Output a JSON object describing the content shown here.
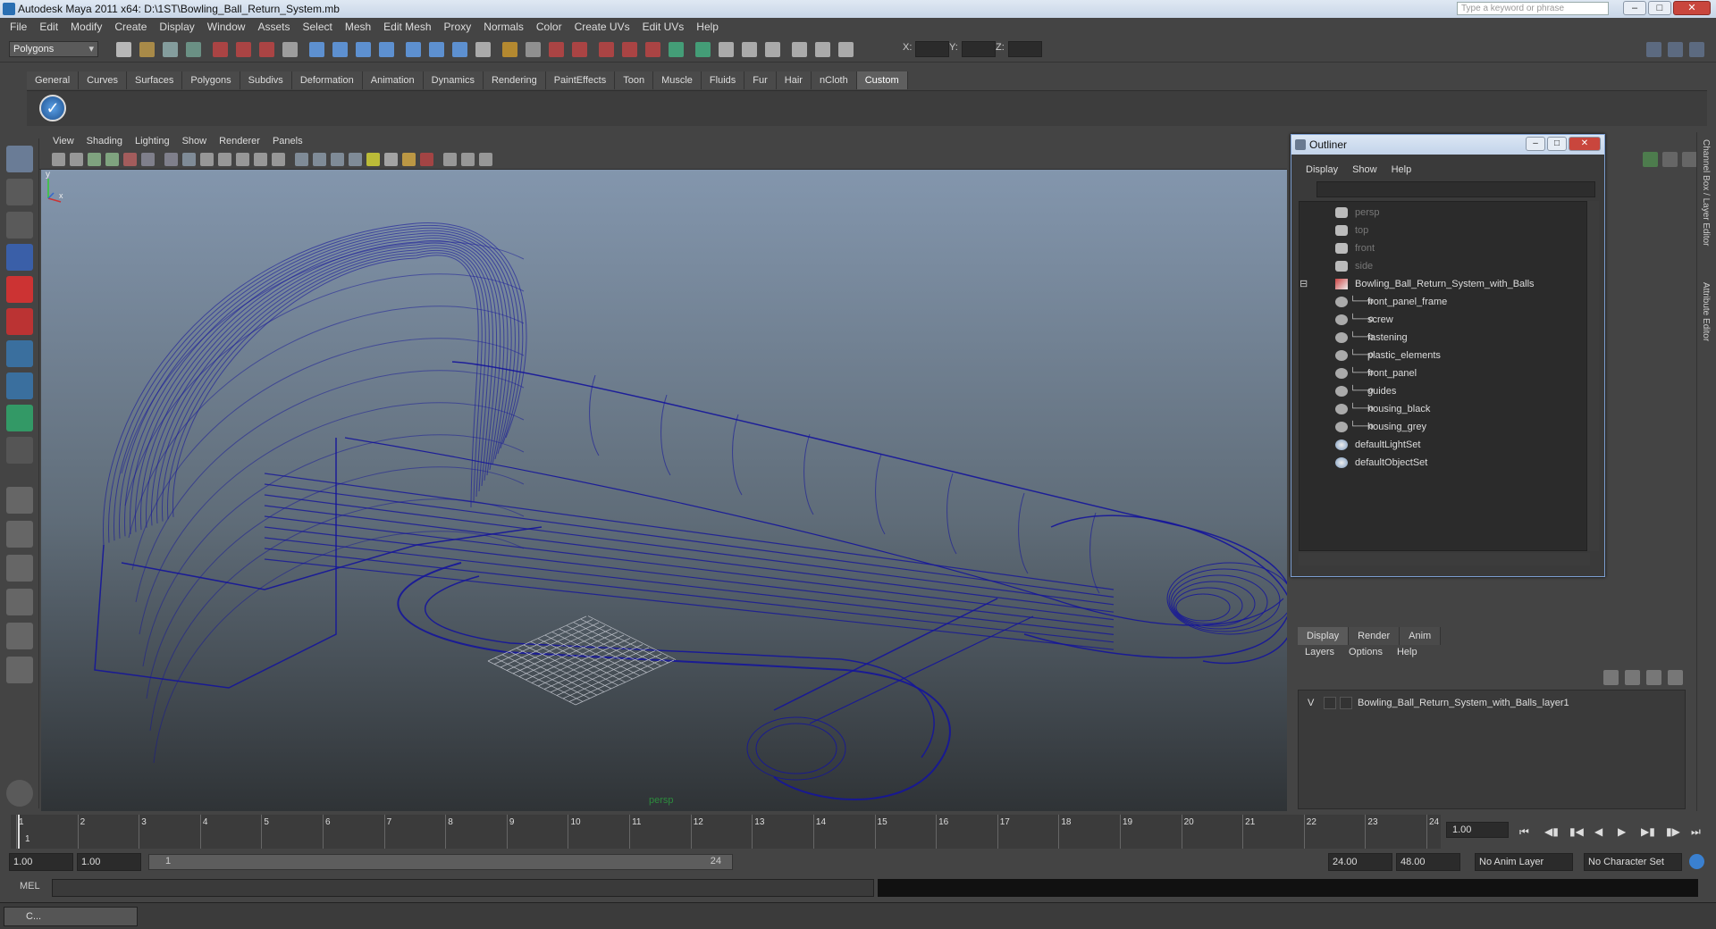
{
  "window": {
    "title": "Autodesk Maya 2011 x64: D:\\1ST\\Bowling_Ball_Return_System.mb",
    "search_placeholder": "Type a keyword or phrase"
  },
  "menubar": [
    "File",
    "Edit",
    "Modify",
    "Create",
    "Display",
    "Window",
    "Assets",
    "Select",
    "Mesh",
    "Edit Mesh",
    "Proxy",
    "Normals",
    "Color",
    "Create UVs",
    "Edit UVs",
    "Help"
  ],
  "status": {
    "mode": "Polygons",
    "x_label": "X:",
    "y_label": "Y:",
    "z_label": "Z:"
  },
  "shelf_tabs": [
    "General",
    "Curves",
    "Surfaces",
    "Polygons",
    "Subdivs",
    "Deformation",
    "Animation",
    "Dynamics",
    "Rendering",
    "PaintEffects",
    "Toon",
    "Muscle",
    "Fluids",
    "Fur",
    "Hair",
    "nCloth",
    "Custom"
  ],
  "shelf_active": "Custom",
  "viewport": {
    "menu": [
      "View",
      "Shading",
      "Lighting",
      "Show",
      "Renderer",
      "Panels"
    ],
    "camera": "persp",
    "axis_y": "y",
    "axis_x": "x",
    "wire_color": "#15159a"
  },
  "outliner": {
    "title": "Outliner",
    "menu": [
      "Display",
      "Show",
      "Help"
    ],
    "items": [
      {
        "name": "persp",
        "kind": "camera",
        "indent": 0,
        "dim": true
      },
      {
        "name": "top",
        "kind": "camera",
        "indent": 0,
        "dim": true
      },
      {
        "name": "front",
        "kind": "camera",
        "indent": 0,
        "dim": true
      },
      {
        "name": "side",
        "kind": "camera",
        "indent": 0,
        "dim": true
      },
      {
        "name": "Bowling_Ball_Return_System_with_Balls",
        "kind": "group",
        "indent": 0,
        "dim": false
      },
      {
        "name": "front_panel_frame",
        "kind": "mesh",
        "indent": 1,
        "dim": false
      },
      {
        "name": "screw",
        "kind": "mesh",
        "indent": 1,
        "dim": false
      },
      {
        "name": "fastening",
        "kind": "mesh",
        "indent": 1,
        "dim": false
      },
      {
        "name": "plastic_elements",
        "kind": "mesh",
        "indent": 1,
        "dim": false
      },
      {
        "name": "front_panel",
        "kind": "mesh",
        "indent": 1,
        "dim": false
      },
      {
        "name": "guides",
        "kind": "mesh",
        "indent": 1,
        "dim": false
      },
      {
        "name": "housing_black",
        "kind": "mesh",
        "indent": 1,
        "dim": false
      },
      {
        "name": "housing_grey",
        "kind": "mesh",
        "indent": 1,
        "dim": false
      },
      {
        "name": "defaultLightSet",
        "kind": "set",
        "indent": 0,
        "dim": false
      },
      {
        "name": "defaultObjectSet",
        "kind": "set",
        "indent": 0,
        "dim": false
      }
    ]
  },
  "right_tabs": {
    "channel": "Channel Box / Layer Editor",
    "attribute": "Attribute Editor"
  },
  "layers": {
    "tabs": [
      "Display",
      "Render",
      "Anim"
    ],
    "menu": [
      "Layers",
      "Options",
      "Help"
    ],
    "rows": [
      {
        "visible": "V",
        "name": "Bowling_Ball_Return_System_with_Balls_layer1"
      }
    ]
  },
  "timeline": {
    "start": 1,
    "end": 24,
    "ticks": [
      "1",
      "2",
      "3",
      "4",
      "5",
      "6",
      "7",
      "8",
      "9",
      "10",
      "11",
      "12",
      "13",
      "14",
      "15",
      "16",
      "17",
      "18",
      "19",
      "20",
      "21",
      "22",
      "23",
      "24"
    ],
    "current_marker": "1",
    "current": "1.00"
  },
  "range": {
    "start": "1.00",
    "start2": "1.00",
    "slider_start": "1",
    "slider_end": "24",
    "end": "24.00",
    "anim_end": "48.00",
    "anim_layer": "No Anim Layer",
    "char_set": "No Character Set"
  },
  "cmdline": {
    "label": "MEL"
  },
  "taskbar": {
    "label": "C..."
  }
}
